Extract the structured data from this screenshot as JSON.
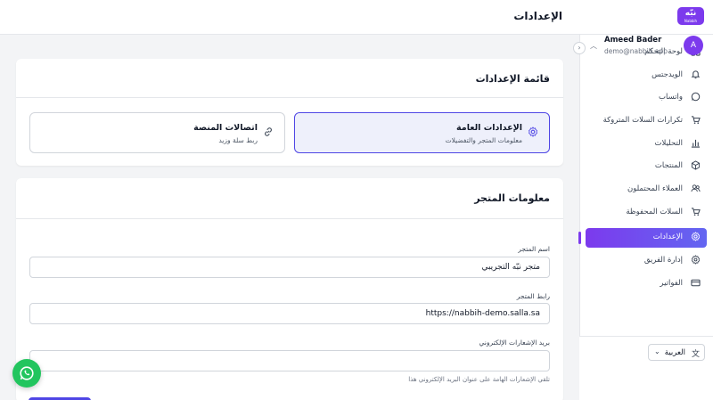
{
  "header": {
    "title": "الإعدادات",
    "logo_text": "نبّه",
    "logo_sub": "Nabbih"
  },
  "sidebar": {
    "collapse_icon": "chevron-right-icon",
    "items": [
      {
        "label": "لوحة التحكم",
        "icon": "grid-icon"
      },
      {
        "label": "الويدجتس",
        "icon": "bell-icon"
      },
      {
        "label": "واتساب",
        "icon": "whatsapp-icon"
      },
      {
        "label": "تكرارات السلات المتروكة",
        "icon": "cart-icon"
      },
      {
        "label": "التحليلات",
        "icon": "bar-chart-icon"
      },
      {
        "label": "المنتجات",
        "icon": "package-icon"
      },
      {
        "label": "العملاء المحتملون",
        "icon": "users-icon"
      },
      {
        "label": "السلات المحفوظة",
        "icon": "cart-icon"
      },
      {
        "label": "الإعدادات",
        "icon": "gear-icon",
        "active": true
      },
      {
        "label": "إدارة الفريق",
        "icon": "team-icon"
      },
      {
        "label": "الفواتير",
        "icon": "credit-card-icon"
      }
    ],
    "language": {
      "label": "العربية",
      "icon": "translate-icon"
    },
    "user": {
      "name": "Ameed Bader",
      "email": "demo@nabbih.app",
      "initial": "A"
    }
  },
  "settings_menu": {
    "title": "قائمة الإعدادات",
    "tiles": [
      {
        "title": "الإعدادات العامة",
        "subtitle": "معلومات المتجر والتفضيلات",
        "icon": "gear-icon",
        "active": true
      },
      {
        "title": "اتصالات المنصة",
        "subtitle": "ربط سلة وزيد",
        "icon": "link-icon",
        "active": false
      }
    ]
  },
  "store_info": {
    "title": "معلومات المتجر",
    "fields": [
      {
        "label": "اسم المتجر",
        "value": "متجر نبّه التجريبي",
        "placeholder": ""
      },
      {
        "label": "رابط المتجر",
        "value": "https://nabbih-demo.salla.sa",
        "placeholder": ""
      },
      {
        "label": "بريد الإشعارات الإلكتروني",
        "value": "",
        "placeholder": "",
        "hint": "تلقي الإشعارات الهامة على عنوان البريد الإلكتروني هذا"
      }
    ]
  },
  "colors": {
    "accent": "#7c3aed",
    "accent_blue": "#4f46e5",
    "whatsapp": "#22c55e"
  }
}
